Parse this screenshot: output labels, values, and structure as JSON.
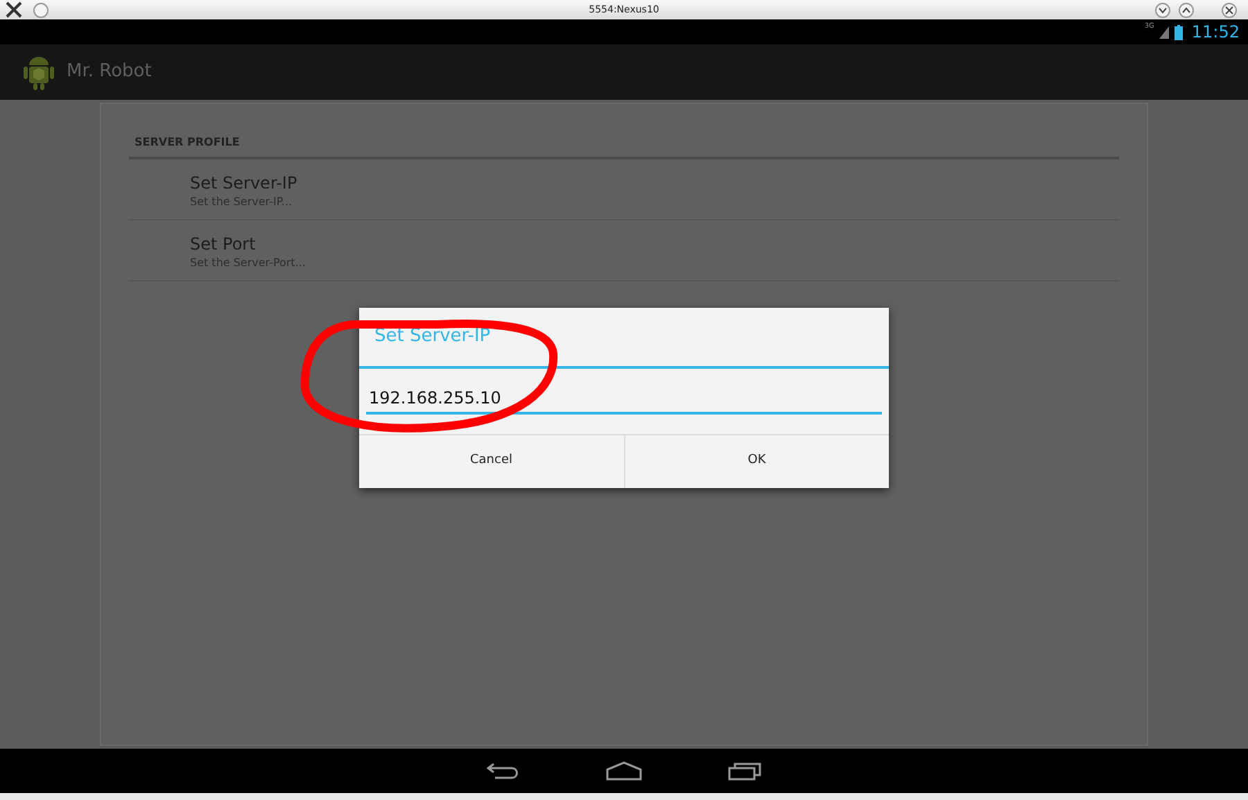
{
  "window": {
    "title": "5554:Nexus10"
  },
  "status_bar": {
    "time": "11:52",
    "network": "3G"
  },
  "action_bar": {
    "title": "Mr. Robot"
  },
  "preferences": {
    "category": "SERVER PROFILE",
    "items": [
      {
        "title": "Set Server-IP",
        "summary": "Set the Server-IP..."
      },
      {
        "title": "Set Port",
        "summary": "Set the Server-Port..."
      }
    ]
  },
  "dialog": {
    "title": "Set Server-IP",
    "value": "192.168.255.10",
    "buttons": [
      "Cancel",
      "OK"
    ]
  }
}
